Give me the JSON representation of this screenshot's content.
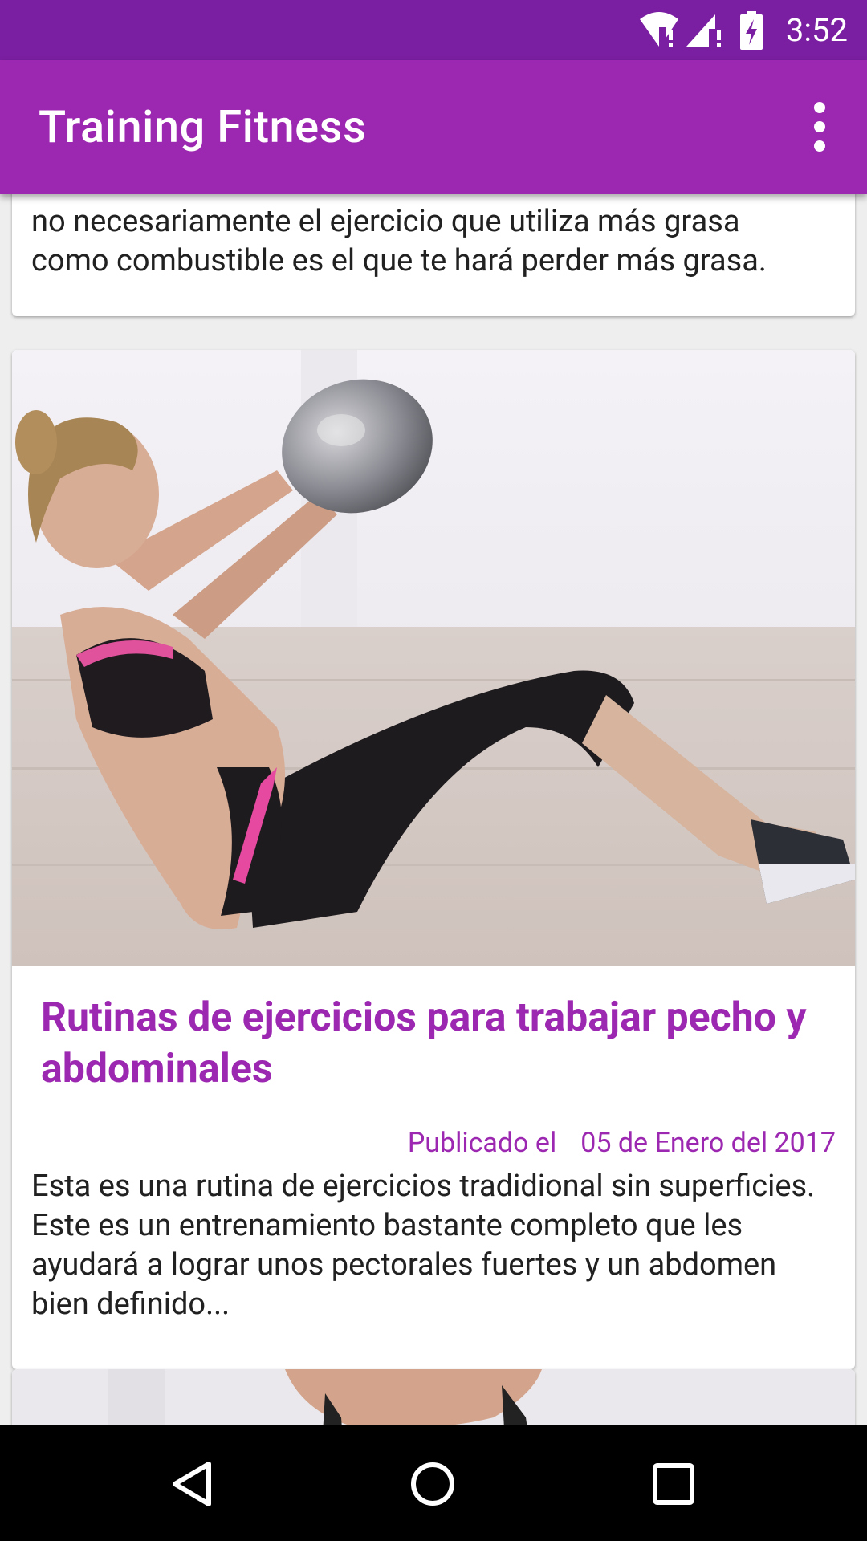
{
  "status_bar": {
    "time": "3:52",
    "icons": [
      "wifi-alert-icon",
      "signal-alert-icon",
      "battery-charging-icon"
    ]
  },
  "app_bar": {
    "title": "Training Fitness",
    "overflow_icon": "more-vert-icon"
  },
  "feed": {
    "cards": [
      {
        "excerpt": "no necesariamente el ejercicio que utiliza más grasa como combustible es el que te hará perder más grasa."
      },
      {
        "image": "woman-doing-situps-with-medicine-ball",
        "title": "Rutinas de ejercicios para trabajar pecho y abdominales",
        "date_prefix": "Publicado el",
        "date": "05 de Enero del 2017",
        "excerpt": "Esta es una rutina de ejercicios tradidional sin superficies.  Este es un entrenamiento bastante completo que les ayudará a lograr unos pectorales fuertes y un abdomen bien definido..."
      },
      {
        "image": "woman-in-black-sports-top"
      }
    ]
  },
  "nav_bar": {
    "buttons": [
      "back-icon",
      "home-icon",
      "recents-icon"
    ]
  },
  "colors": {
    "status_bar": "#7b1fa2",
    "primary": "#9c27b0",
    "background": "#eeeeee"
  }
}
